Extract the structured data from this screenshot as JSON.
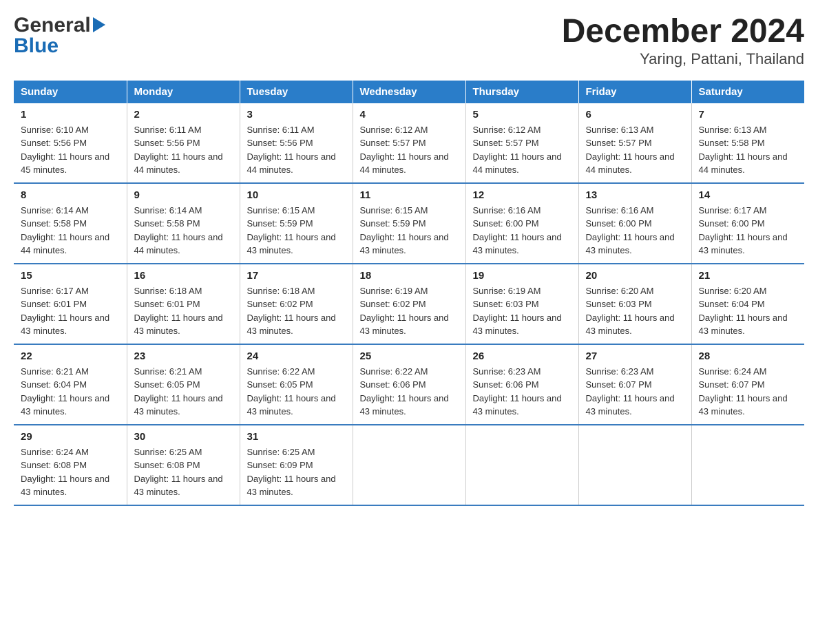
{
  "logo": {
    "general": "General",
    "blue": "Blue",
    "arrow": "▶"
  },
  "title": "December 2024",
  "subtitle": "Yaring, Pattani, Thailand",
  "weekdays": [
    "Sunday",
    "Monday",
    "Tuesday",
    "Wednesday",
    "Thursday",
    "Friday",
    "Saturday"
  ],
  "weeks": [
    [
      {
        "day": "1",
        "sunrise": "6:10 AM",
        "sunset": "5:56 PM",
        "daylight": "11 hours and 45 minutes."
      },
      {
        "day": "2",
        "sunrise": "6:11 AM",
        "sunset": "5:56 PM",
        "daylight": "11 hours and 44 minutes."
      },
      {
        "day": "3",
        "sunrise": "6:11 AM",
        "sunset": "5:56 PM",
        "daylight": "11 hours and 44 minutes."
      },
      {
        "day": "4",
        "sunrise": "6:12 AM",
        "sunset": "5:57 PM",
        "daylight": "11 hours and 44 minutes."
      },
      {
        "day": "5",
        "sunrise": "6:12 AM",
        "sunset": "5:57 PM",
        "daylight": "11 hours and 44 minutes."
      },
      {
        "day": "6",
        "sunrise": "6:13 AM",
        "sunset": "5:57 PM",
        "daylight": "11 hours and 44 minutes."
      },
      {
        "day": "7",
        "sunrise": "6:13 AM",
        "sunset": "5:58 PM",
        "daylight": "11 hours and 44 minutes."
      }
    ],
    [
      {
        "day": "8",
        "sunrise": "6:14 AM",
        "sunset": "5:58 PM",
        "daylight": "11 hours and 44 minutes."
      },
      {
        "day": "9",
        "sunrise": "6:14 AM",
        "sunset": "5:58 PM",
        "daylight": "11 hours and 44 minutes."
      },
      {
        "day": "10",
        "sunrise": "6:15 AM",
        "sunset": "5:59 PM",
        "daylight": "11 hours and 43 minutes."
      },
      {
        "day": "11",
        "sunrise": "6:15 AM",
        "sunset": "5:59 PM",
        "daylight": "11 hours and 43 minutes."
      },
      {
        "day": "12",
        "sunrise": "6:16 AM",
        "sunset": "6:00 PM",
        "daylight": "11 hours and 43 minutes."
      },
      {
        "day": "13",
        "sunrise": "6:16 AM",
        "sunset": "6:00 PM",
        "daylight": "11 hours and 43 minutes."
      },
      {
        "day": "14",
        "sunrise": "6:17 AM",
        "sunset": "6:00 PM",
        "daylight": "11 hours and 43 minutes."
      }
    ],
    [
      {
        "day": "15",
        "sunrise": "6:17 AM",
        "sunset": "6:01 PM",
        "daylight": "11 hours and 43 minutes."
      },
      {
        "day": "16",
        "sunrise": "6:18 AM",
        "sunset": "6:01 PM",
        "daylight": "11 hours and 43 minutes."
      },
      {
        "day": "17",
        "sunrise": "6:18 AM",
        "sunset": "6:02 PM",
        "daylight": "11 hours and 43 minutes."
      },
      {
        "day": "18",
        "sunrise": "6:19 AM",
        "sunset": "6:02 PM",
        "daylight": "11 hours and 43 minutes."
      },
      {
        "day": "19",
        "sunrise": "6:19 AM",
        "sunset": "6:03 PM",
        "daylight": "11 hours and 43 minutes."
      },
      {
        "day": "20",
        "sunrise": "6:20 AM",
        "sunset": "6:03 PM",
        "daylight": "11 hours and 43 minutes."
      },
      {
        "day": "21",
        "sunrise": "6:20 AM",
        "sunset": "6:04 PM",
        "daylight": "11 hours and 43 minutes."
      }
    ],
    [
      {
        "day": "22",
        "sunrise": "6:21 AM",
        "sunset": "6:04 PM",
        "daylight": "11 hours and 43 minutes."
      },
      {
        "day": "23",
        "sunrise": "6:21 AM",
        "sunset": "6:05 PM",
        "daylight": "11 hours and 43 minutes."
      },
      {
        "day": "24",
        "sunrise": "6:22 AM",
        "sunset": "6:05 PM",
        "daylight": "11 hours and 43 minutes."
      },
      {
        "day": "25",
        "sunrise": "6:22 AM",
        "sunset": "6:06 PM",
        "daylight": "11 hours and 43 minutes."
      },
      {
        "day": "26",
        "sunrise": "6:23 AM",
        "sunset": "6:06 PM",
        "daylight": "11 hours and 43 minutes."
      },
      {
        "day": "27",
        "sunrise": "6:23 AM",
        "sunset": "6:07 PM",
        "daylight": "11 hours and 43 minutes."
      },
      {
        "day": "28",
        "sunrise": "6:24 AM",
        "sunset": "6:07 PM",
        "daylight": "11 hours and 43 minutes."
      }
    ],
    [
      {
        "day": "29",
        "sunrise": "6:24 AM",
        "sunset": "6:08 PM",
        "daylight": "11 hours and 43 minutes."
      },
      {
        "day": "30",
        "sunrise": "6:25 AM",
        "sunset": "6:08 PM",
        "daylight": "11 hours and 43 minutes."
      },
      {
        "day": "31",
        "sunrise": "6:25 AM",
        "sunset": "6:09 PM",
        "daylight": "11 hours and 43 minutes."
      },
      null,
      null,
      null,
      null
    ]
  ],
  "labels": {
    "sunrise": "Sunrise:",
    "sunset": "Sunset:",
    "daylight": "Daylight:"
  }
}
